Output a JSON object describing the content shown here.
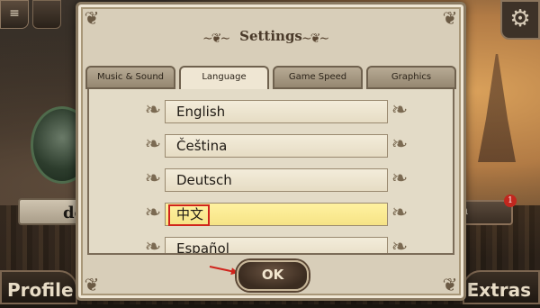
{
  "background": {
    "name_plate": "do",
    "right_plate": "n",
    "notification_count": "1",
    "profile_label": "Profile",
    "extras_label": "Extras"
  },
  "dialog": {
    "title": "Settings",
    "tabs": [
      {
        "label": "Music & Sound",
        "active": false
      },
      {
        "label": "Language",
        "active": true
      },
      {
        "label": "Game Speed",
        "active": false
      },
      {
        "label": "Graphics",
        "active": false
      }
    ],
    "languages": [
      {
        "label": "English",
        "selected": false
      },
      {
        "label": "Čeština",
        "selected": false
      },
      {
        "label": "Deutsch",
        "selected": false
      },
      {
        "label": "中文",
        "selected": true
      },
      {
        "label": "Español",
        "selected": false
      }
    ],
    "ok_label": "OK"
  },
  "colors": {
    "highlight": "#d0241c",
    "selected_row": "#fff2a0"
  }
}
